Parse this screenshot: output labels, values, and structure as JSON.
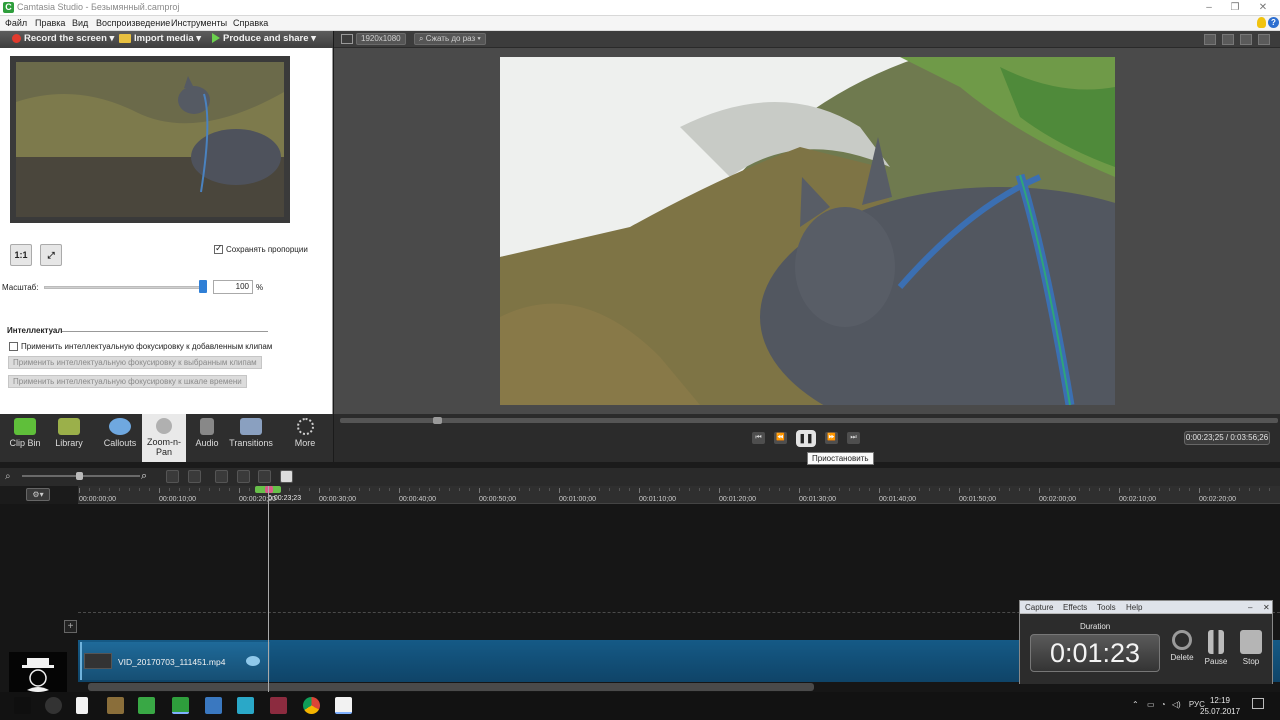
{
  "window": {
    "title": "Camtasia Studio - Безымянный.camproj",
    "app_icon_letter": "C"
  },
  "menu": {
    "items": [
      "Файл",
      "Правка",
      "Вид",
      "Воспроизведение",
      "Инструменты",
      "Справка"
    ]
  },
  "toolbar": {
    "record_label": "Record the screen",
    "import_label": "Import media",
    "produce_label": "Produce and share"
  },
  "preview_bar": {
    "resolution": "1920x1080",
    "zoom_label": "Сжать до раз"
  },
  "zoom_panel": {
    "one_to_one": "1:1",
    "keep_ratio_label": "Сохранять пропорции",
    "keep_ratio_checked": true,
    "scale_label": "Масштаб:",
    "scale_value": "100",
    "scale_unit": "%",
    "scale_fraction": 1.0,
    "smart_section": "Интеллектуал",
    "smart_apply_new_label": "Применить интеллектуальную фокусировку к добавленным клипам",
    "smart_apply_new_checked": false,
    "apply_selected_button": "Применить интеллектуальную фокусировку к выбранным клипам",
    "apply_timeline_button": "Применить интеллектуальную фокусировку к шкале времени"
  },
  "tasks": [
    {
      "label": "Clip Bin",
      "icon": "film-icon",
      "color": "#5fbf3a"
    },
    {
      "label": "Library",
      "icon": "library-icon",
      "color": "#9bb04a"
    },
    {
      "label": "Callouts",
      "icon": "callout-icon",
      "color": "#6fa8e0"
    },
    {
      "label": "Zoom-n-Pan",
      "icon": "magnifier-icon",
      "color": "#b0b0b0"
    },
    {
      "label": "Audio",
      "icon": "audio-icon",
      "color": "#888888"
    },
    {
      "label": "Transitions",
      "icon": "transitions-icon",
      "color": "#8aa0c0"
    },
    {
      "label": "More",
      "icon": "more-icon",
      "color": "#cfcfcf"
    }
  ],
  "playback": {
    "tooltip": "Приостановить",
    "timecode": "0:00:23;25 / 0:03:56;26",
    "progress": 0.1
  },
  "timeline": {
    "ticks": [
      "00:00:00;00",
      "00:00:10;00",
      "00:00:20;00",
      "00:00:30;00",
      "00:00:40;00",
      "00:00:50;00",
      "00:01:00;00",
      "00:01:10;00",
      "00:01:20;00",
      "00:01:30;00",
      "00:01:40;00",
      "00:01:50;00",
      "00:02:00;00",
      "00:02:10;00",
      "00:02:20;00"
    ],
    "playhead": "0:00:23;23",
    "clip_name": "VID_20170703_111451.mp4"
  },
  "recorder": {
    "menu": [
      "Capture",
      "Effects",
      "Tools",
      "Help"
    ],
    "duration_label": "Duration",
    "duration": "0:01:23",
    "buttons": [
      "Delete",
      "Pause",
      "Stop"
    ]
  },
  "taskbar": {
    "lang": "РУС",
    "time": "12:19",
    "date": "25.07.2017"
  },
  "colors": {
    "accent_blue": "#2f7fd6",
    "track_blue": "#155a86",
    "panel_dark": "#2b2b2b"
  }
}
